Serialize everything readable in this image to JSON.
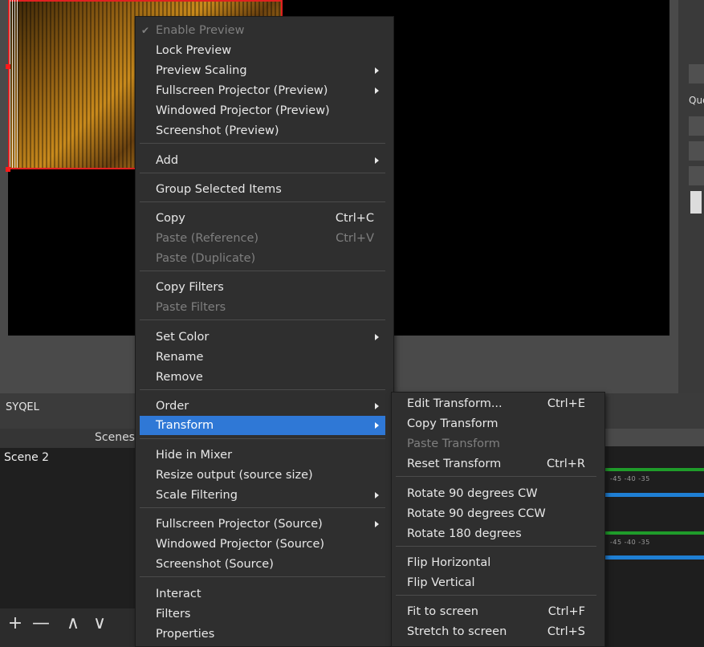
{
  "profile": {
    "name": "SYQEL"
  },
  "right_panel": {
    "label": "Que"
  },
  "scenes": {
    "title": "Scenes",
    "items": [
      "Scene 2"
    ],
    "toolbar": {
      "add": "+",
      "remove": "—",
      "up": "∧",
      "down": "∨"
    }
  },
  "mixer": {
    "tick_row_1": "-45   -40   -35",
    "tick_row_2": "-45   -40   -35"
  },
  "context_menu": {
    "enable_preview": "Enable Preview",
    "lock_preview": "Lock Preview",
    "preview_scaling": "Preview Scaling",
    "fullscreen_projector_preview": "Fullscreen Projector (Preview)",
    "windowed_projector_preview": "Windowed Projector (Preview)",
    "screenshot_preview": "Screenshot (Preview)",
    "add": "Add",
    "group_selected": "Group Selected Items",
    "copy": "Copy",
    "copy_shortcut": "Ctrl+C",
    "paste_reference": "Paste (Reference)",
    "paste_shortcut": "Ctrl+V",
    "paste_duplicate": "Paste (Duplicate)",
    "copy_filters": "Copy Filters",
    "paste_filters": "Paste Filters",
    "set_color": "Set Color",
    "rename": "Rename",
    "remove": "Remove",
    "order": "Order",
    "transform": "Transform",
    "hide_in_mixer": "Hide in Mixer",
    "resize_output": "Resize output (source size)",
    "scale_filtering": "Scale Filtering",
    "fullscreen_projector_source": "Fullscreen Projector (Source)",
    "windowed_projector_source": "Windowed Projector (Source)",
    "screenshot_source": "Screenshot (Source)",
    "interact": "Interact",
    "filters": "Filters",
    "properties": "Properties"
  },
  "transform_menu": {
    "edit_transform": "Edit Transform...",
    "edit_shortcut": "Ctrl+E",
    "copy_transform": "Copy Transform",
    "paste_transform": "Paste Transform",
    "reset_transform": "Reset Transform",
    "reset_shortcut": "Ctrl+R",
    "rotate_cw": "Rotate 90 degrees CW",
    "rotate_ccw": "Rotate 90 degrees CCW",
    "rotate_180": "Rotate 180 degrees",
    "flip_horizontal": "Flip Horizontal",
    "flip_vertical": "Flip Vertical",
    "fit_to_screen": "Fit to screen",
    "fit_shortcut": "Ctrl+F",
    "stretch_to_screen": "Stretch to screen",
    "stretch_shortcut": "Ctrl+S"
  },
  "colors": {
    "highlight": "#2f78d6",
    "selection_border": "#e02020",
    "menu_bg": "#2f2f2f"
  }
}
